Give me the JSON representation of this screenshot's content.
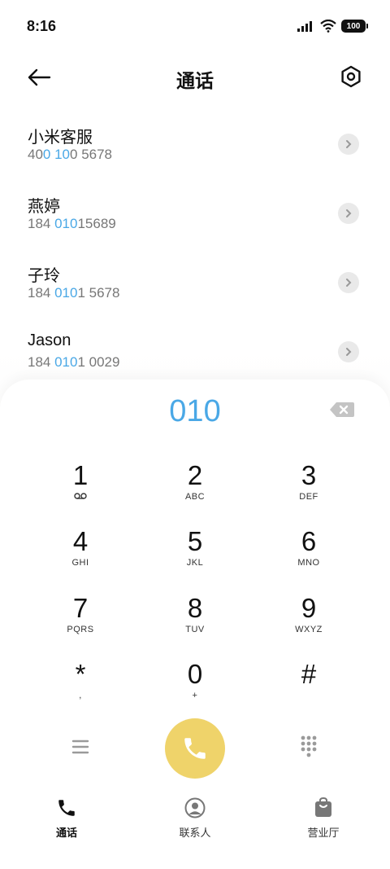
{
  "status_bar": {
    "time": "8:16",
    "battery": "100"
  },
  "header": {
    "title": "通话"
  },
  "contacts": [
    {
      "name": "小米客服",
      "number_parts": [
        "40",
        "0 10",
        "0 5678"
      ]
    },
    {
      "name": "燕婷",
      "number_parts": [
        "184 ",
        "010",
        "15689"
      ]
    },
    {
      "name": "子玲",
      "number_parts": [
        "184 ",
        "010",
        "1 5678"
      ]
    },
    {
      "name": "Jason",
      "number_parts": [
        "184 ",
        "010",
        "1 0029"
      ]
    }
  ],
  "dialer": {
    "input": "010",
    "keys": [
      {
        "digit": "1",
        "sub": ""
      },
      {
        "digit": "2",
        "sub": "ABC"
      },
      {
        "digit": "3",
        "sub": "DEF"
      },
      {
        "digit": "4",
        "sub": "GHI"
      },
      {
        "digit": "5",
        "sub": "JKL"
      },
      {
        "digit": "6",
        "sub": "MNO"
      },
      {
        "digit": "7",
        "sub": "PQRS"
      },
      {
        "digit": "8",
        "sub": "TUV"
      },
      {
        "digit": "9",
        "sub": "WXYZ"
      },
      {
        "digit": "*",
        "sub": ","
      },
      {
        "digit": "0",
        "sub": "+"
      },
      {
        "digit": "#",
        "sub": ""
      }
    ]
  },
  "bottom_nav": {
    "calls": "通话",
    "contacts": "联系人",
    "store": "营业厅"
  },
  "colors": {
    "accent": "#4aa8e6",
    "call_button": "#efd36a"
  }
}
